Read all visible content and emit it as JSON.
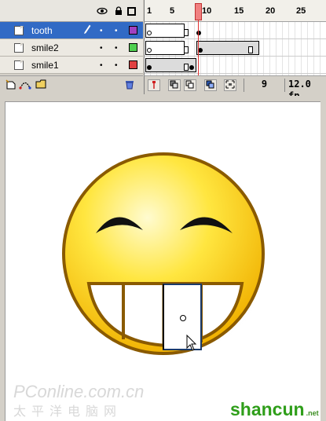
{
  "timeline": {
    "layers": [
      {
        "name": "tooth",
        "selected": true,
        "color": "#a040c0",
        "editing": true
      },
      {
        "name": "smile2",
        "selected": false,
        "color": "#50d050",
        "editing": false
      },
      {
        "name": "smile1",
        "selected": false,
        "color": "#e04040",
        "editing": false
      }
    ],
    "icons": {
      "eye": "eye-icon",
      "lock": "lock-icon",
      "outline": "outline-icon",
      "pencil": "pencil-icon",
      "visible_dot": "•",
      "lock_dot": "•"
    },
    "ruler": [
      "1",
      "5",
      "10",
      "15",
      "20",
      "25"
    ],
    "current_frame": "9",
    "frame_rate": "12.0 fp",
    "layer_toolbar": {
      "insert_layer": "insert-layer-icon",
      "add_motion_guide": "motion-guide-icon",
      "insert_folder": "insert-folder-icon",
      "delete_layer": "trash-icon"
    },
    "frame_toolbar": {
      "center_frame": "center-frame-icon",
      "onion_skin": "onion-skin-icon",
      "onion_outlines": "onion-outlines-icon",
      "edit_multiple": "edit-multiple-icon",
      "modify_markers": "modify-markers-icon"
    }
  },
  "stage": {
    "colors": {
      "face_light": "#fff6a0",
      "face_dark": "#f0b800",
      "outline": "#8a5a00",
      "teeth": "#ffffff",
      "selection": "#1a3a6a"
    }
  },
  "watermarks": {
    "left_main": "PConline.com.cn",
    "left_sub": "太平洋电脑网",
    "right_main": "shancun",
    "right_sub": ".net"
  }
}
